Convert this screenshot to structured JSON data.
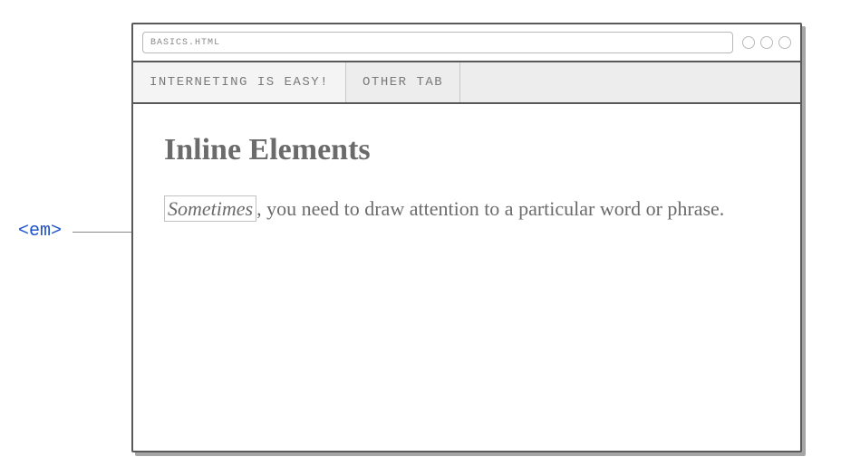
{
  "annotation": {
    "tag_label": "<em>"
  },
  "browser": {
    "address": "BASICS.HTML",
    "tabs": [
      {
        "label": "INTERNETING IS EASY!",
        "active": true
      },
      {
        "label": "OTHER TAB",
        "active": false
      }
    ]
  },
  "page": {
    "heading": "Inline Elements",
    "em_word": "Sometimes",
    "rest_text": ", you need to draw attention to a particular word or phrase."
  }
}
